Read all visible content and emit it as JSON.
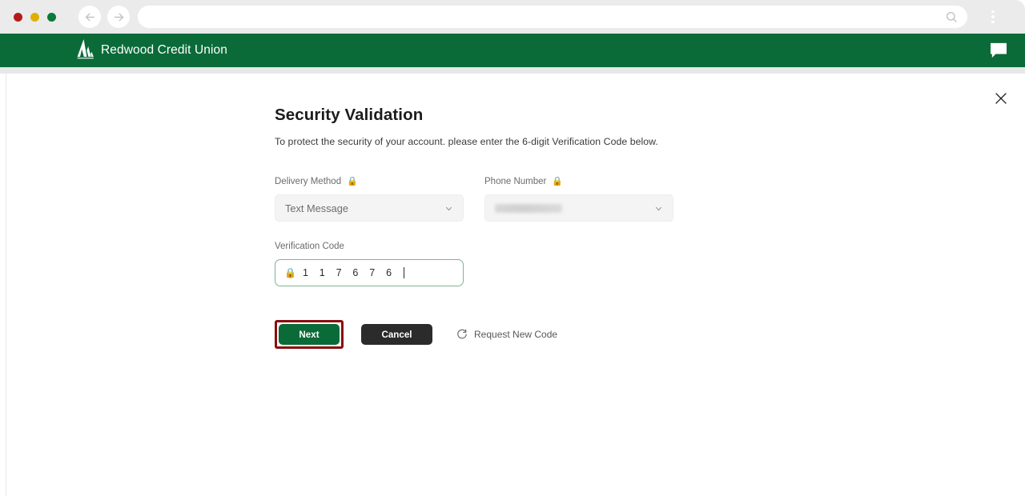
{
  "browser": {
    "traffic_lights": [
      "close",
      "minimize",
      "maximize"
    ],
    "back_icon": "back-arrow-icon",
    "forward_icon": "forward-arrow-icon",
    "url_value": "",
    "url_placeholder": "",
    "search_icon": "search-icon",
    "menu_icon": "kebab-menu-icon"
  },
  "site_header": {
    "brand_name": "Redwood Credit Union",
    "logo_icon": "redwood-tree-logo-icon",
    "chat_icon": "chat-bubble-icon",
    "background_color": "#0a6b38"
  },
  "modal": {
    "close_icon": "close-icon",
    "title": "Security Validation",
    "subtitle": "To protect the security of your account. please enter the 6-digit Verification Code below."
  },
  "form": {
    "delivery_method": {
      "label": "Delivery Method",
      "lock_icon": "lock-icon",
      "lock_glyph": "🔒",
      "value": "Text Message",
      "chevron_icon": "chevron-down-icon"
    },
    "phone_number": {
      "label": "Phone Number",
      "lock_icon": "lock-icon",
      "lock_glyph": "🔒",
      "value": "",
      "redacted": true,
      "chevron_icon": "chevron-down-icon"
    },
    "verification_code": {
      "label": "Verification Code",
      "lock_icon": "lock-icon",
      "lock_glyph": "🔒",
      "value": "1 1 7 6 7 6",
      "focused": true,
      "border_color": "#7fb394"
    }
  },
  "actions": {
    "next_label": "Next",
    "next_color": "#0a6b38",
    "highlight_color": "#8a0d0d",
    "cancel_label": "Cancel",
    "cancel_color": "#2b2b2b",
    "request_new_code_label": "Request New Code",
    "request_new_code_icon": "refresh-icon"
  }
}
